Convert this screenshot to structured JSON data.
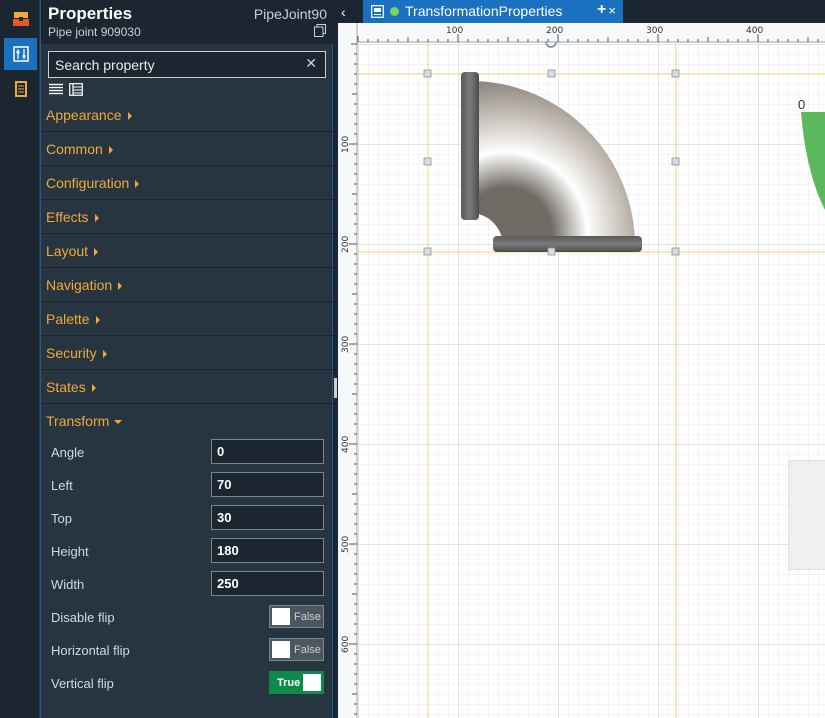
{
  "panel": {
    "title": "Properties",
    "object_name": "PipeJoint90",
    "object_subtitle": "Pipe joint 909030",
    "search": {
      "placeholder": "Search property",
      "value": ""
    },
    "categories": [
      {
        "label": "Appearance"
      },
      {
        "label": "Common"
      },
      {
        "label": "Configuration"
      },
      {
        "label": "Effects"
      },
      {
        "label": "Layout"
      },
      {
        "label": "Navigation"
      },
      {
        "label": "Palette"
      },
      {
        "label": "Security"
      },
      {
        "label": "States"
      }
    ],
    "transform": {
      "label": "Transform",
      "expanded": true,
      "fields": [
        {
          "label": "Angle",
          "value": "0"
        },
        {
          "label": "Left",
          "value": "70"
        },
        {
          "label": "Top",
          "value": "30"
        },
        {
          "label": "Height",
          "value": "180"
        },
        {
          "label": "Width",
          "value": "250"
        }
      ],
      "toggles": [
        {
          "label": "Disable flip",
          "state": "False",
          "on": false
        },
        {
          "label": "Horizontal flip",
          "state": "False",
          "on": false
        },
        {
          "label": "Vertical flip",
          "state": "True",
          "on": true
        }
      ]
    }
  },
  "tabs": {
    "active": {
      "title": "TransformationProperties",
      "close": "×"
    },
    "add": "+",
    "back": "‹"
  },
  "canvas": {
    "ruler_h": [
      "100",
      "200",
      "300",
      "400"
    ],
    "ruler_v": [
      "100",
      "200",
      "300",
      "400",
      "500",
      "600"
    ],
    "shape_label": "0"
  },
  "icons": {
    "rail": [
      "toolbox-icon",
      "properties-icon",
      "book-icon"
    ],
    "panel": [
      "copy-icon",
      "clear-icon",
      "list-view-icon",
      "grid-view-icon"
    ],
    "tab": [
      "display-icon",
      "status-dot-icon",
      "close-icon",
      "add-tab-icon"
    ]
  },
  "colors": {
    "accent": "#1a71c0",
    "category_text": "#f2a93b",
    "toggle_on": "#0e8a4a",
    "status_dot": "#7dd35d",
    "guide": "#f5d36b",
    "green_shape": "#5cb85c"
  }
}
